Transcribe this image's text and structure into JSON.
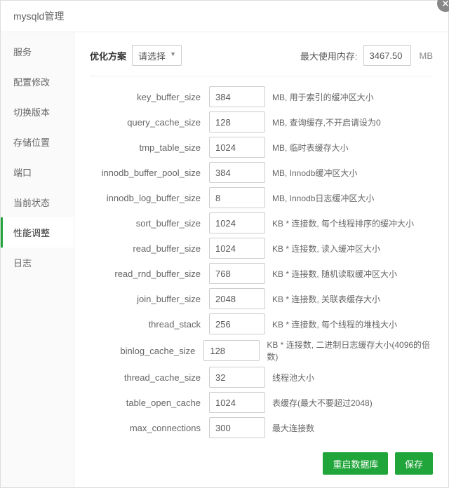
{
  "title": "mysqld管理",
  "sidebar": {
    "items": [
      {
        "label": "服务"
      },
      {
        "label": "配置修改"
      },
      {
        "label": "切换版本"
      },
      {
        "label": "存储位置"
      },
      {
        "label": "端口"
      },
      {
        "label": "当前状态"
      },
      {
        "label": "性能调整"
      },
      {
        "label": "日志"
      }
    ],
    "activeIndex": 6
  },
  "top": {
    "plan_label": "优化方案",
    "plan_selected": "请选择",
    "mem_label": "最大使用内存:",
    "mem_value": "3467.50",
    "mem_unit": "MB"
  },
  "params": [
    {
      "name": "key_buffer_size",
      "value": "384",
      "desc": "MB, 用于索引的缓冲区大小"
    },
    {
      "name": "query_cache_size",
      "value": "128",
      "desc": "MB, 查询缓存,不开启请设为0"
    },
    {
      "name": "tmp_table_size",
      "value": "1024",
      "desc": "MB, 临时表缓存大小"
    },
    {
      "name": "innodb_buffer_pool_size",
      "value": "384",
      "desc": "MB, Innodb缓冲区大小"
    },
    {
      "name": "innodb_log_buffer_size",
      "value": "8",
      "desc": "MB, Innodb日志缓冲区大小"
    },
    {
      "name": "sort_buffer_size",
      "value": "1024",
      "desc": "KB * 连接数, 每个线程排序的缓冲大小"
    },
    {
      "name": "read_buffer_size",
      "value": "1024",
      "desc": "KB * 连接数, 读入缓冲区大小"
    },
    {
      "name": "read_rnd_buffer_size",
      "value": "768",
      "desc": "KB * 连接数, 随机读取缓冲区大小"
    },
    {
      "name": "join_buffer_size",
      "value": "2048",
      "desc": "KB * 连接数, 关联表缓存大小"
    },
    {
      "name": "thread_stack",
      "value": "256",
      "desc": "KB * 连接数, 每个线程的堆栈大小"
    },
    {
      "name": "binlog_cache_size",
      "value": "128",
      "desc": "KB * 连接数, 二进制日志缓存大小(4096的倍数)"
    },
    {
      "name": "thread_cache_size",
      "value": "32",
      "desc": "线程池大小"
    },
    {
      "name": "table_open_cache",
      "value": "1024",
      "desc": "表缓存(最大不要超过2048)"
    },
    {
      "name": "max_connections",
      "value": "300",
      "desc": "最大连接数"
    }
  ],
  "buttons": {
    "restart": "重启数据库",
    "save": "保存"
  }
}
